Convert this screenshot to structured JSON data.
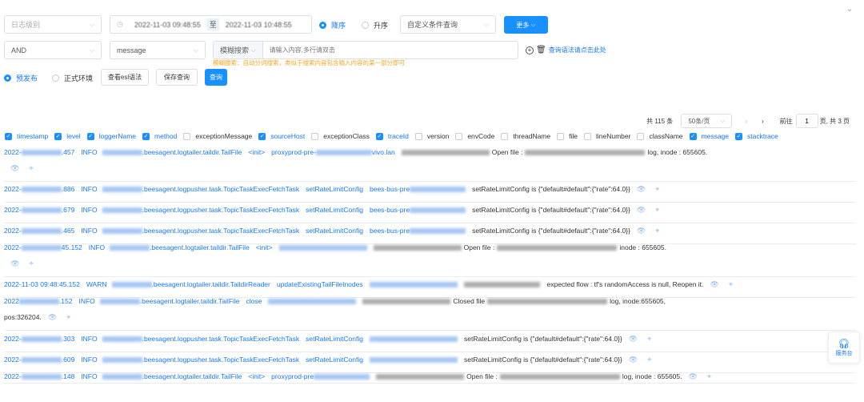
{
  "filters": {
    "level_placeholder": "日志级别",
    "date_from": "2022-11-03 09:48:55",
    "date_sep": "至",
    "date_to": "2022-11-03 10:48:55",
    "desc": "降序",
    "asc": "升序",
    "custom_query": "自定义条件查询",
    "more": "更多"
  },
  "row2": {
    "logic": "AND",
    "field": "message",
    "mode": "模糊搜索",
    "input_placeholder": "请输入内容,多行请双击",
    "syntax_link": "查询语法请点击此处",
    "hint": "模糊搜索：自动分词搜索，类似于搜索内容包含输入内容的某一部分即可"
  },
  "row3": {
    "env_pre": "预发布",
    "env_prod": "正式环境",
    "esl_btn": "查看esl语法",
    "save_btn": "保存查询",
    "query_btn": "查询"
  },
  "pagination": {
    "total": "共 115 条",
    "page_size": "50条/页",
    "prev": "‹",
    "next": "›",
    "goto": "前往",
    "page": "1",
    "pages": "页, 共 3 页"
  },
  "columns": [
    {
      "label": "timestamp",
      "checked": true
    },
    {
      "label": "level",
      "checked": true
    },
    {
      "label": "loggerName",
      "checked": true
    },
    {
      "label": "method",
      "checked": true
    },
    {
      "label": "exceptionMessage",
      "checked": false
    },
    {
      "label": "sourceHost",
      "checked": true
    },
    {
      "label": "exceptionClass",
      "checked": false
    },
    {
      "label": "traceId",
      "checked": true
    },
    {
      "label": "version",
      "checked": false
    },
    {
      "label": "envCode",
      "checked": false
    },
    {
      "label": "threadName",
      "checked": false
    },
    {
      "label": "file",
      "checked": false
    },
    {
      "label": "lineNumber",
      "checked": false
    },
    {
      "label": "className",
      "checked": false
    },
    {
      "label": "message",
      "checked": true
    },
    {
      "label": "stacktrace",
      "checked": true
    }
  ],
  "logs": [
    {
      "ts": "2022-",
      "ts_tail": ".457",
      "level": "INFO",
      "logger": ".beesagent.logtailer.taildir.TailFile",
      "method": "<init>",
      "host": "proxyprod-pre-",
      "host_tail": "vivo.lan",
      "msg": "Open file :",
      "msg_tail": "log, inode : 655605.",
      "wrap": true
    },
    {
      "ts": "2022-",
      "ts_tail": ".886",
      "level": "INFO",
      "logger": ".beesagent.logpusher.task.TopicTaskExecFetchTask",
      "method": "setRateLimitConfig",
      "host": "bees-bus-pre",
      "host_tail": "",
      "msg": "setRateLimitConfig is {\"default#default\":{\"rate\":64.0}}",
      "msg_tail": "",
      "wrap": false
    },
    {
      "ts": "2022-",
      "ts_tail": ".679",
      "level": "INFO",
      "logger": ".beesagent.logpusher.task.TopicTaskExecFetchTask",
      "method": "setRateLimitConfig",
      "host": "bees-bus-pre",
      "host_tail": "",
      "msg": "setRateLimitConfig is {\"default#default\":{\"rate\":64.0}}",
      "msg_tail": "",
      "wrap": false
    },
    {
      "ts": "2022-",
      "ts_tail": ".465",
      "level": "INFO",
      "logger": ".beesagent.logpusher.task.TopicTaskExecFetchTask",
      "method": "setRateLimitConfig",
      "host": "bees-bus-pre",
      "host_tail": "",
      "msg": "setRateLimitConfig is {\"default#default\":{\"rate\":64.0}}",
      "msg_tail": "",
      "wrap": false
    },
    {
      "ts": "2022-",
      "ts_tail": "45.152",
      "level": "INFO",
      "logger": ".beesagent.logtailer.taildir.TailFile",
      "method": "<init>",
      "host": "",
      "host_tail": "",
      "msg": "Open file :",
      "msg_tail": "inode : 655605.",
      "wrap": true
    },
    {
      "ts": "2022-11-03 09:48:45.152",
      "ts_tail": "",
      "level": "WARN",
      "logger": ".beesagent.logtailer.taildir.TaildirReader",
      "method": "updateExistingTailFileInodes",
      "host": "",
      "host_tail": "",
      "msg": "",
      "msg_tail": "expected flow : tf's randomAccess is null, Reopen it.",
      "wrap": false
    },
    {
      "ts": "2022",
      "ts_tail": ".152",
      "level": "INFO",
      "logger": ".beesagent.logtailer.taildir.TailFile",
      "method": "close",
      "host": "",
      "host_tail": "",
      "msg": "Closed file",
      "msg_tail": "log, inode:655605,",
      "wrap": true,
      "wrap_text": "pos:326204."
    },
    {
      "ts": "2022-",
      "ts_tail": ".303",
      "level": "INFO",
      "logger": ".beesagent.logpusher.task.TopicTaskExecFetchTask",
      "method": "setRateLimitConfig",
      "host": "",
      "host_tail": "",
      "msg": "setRateLimitConfig is {\"default#default\":{\"rate\":64.0}}",
      "msg_tail": "",
      "wrap": false
    },
    {
      "ts": "2022-",
      "ts_tail": ".609",
      "level": "INFO",
      "logger": ".beesagent.logpusher.task.TopicTaskExecFetchTask",
      "method": "setRateLimitConfig",
      "host": "",
      "host_tail": "",
      "msg": "setRateLimitConfig is {\"default#default\":{\"rate\":64.0}}",
      "msg_tail": "",
      "wrap": false
    },
    {
      "ts": "2022-",
      "ts_tail": ".148",
      "level": "INFO",
      "logger": ".beesagent.logtailer.taildir.TailFile",
      "method": "<init>",
      "host": "proxyprod-pre",
      "host_tail": "",
      "msg": "Open file :",
      "msg_tail": "log, inode : 655605.",
      "wrap": false
    }
  ],
  "service_desk": "服务台"
}
